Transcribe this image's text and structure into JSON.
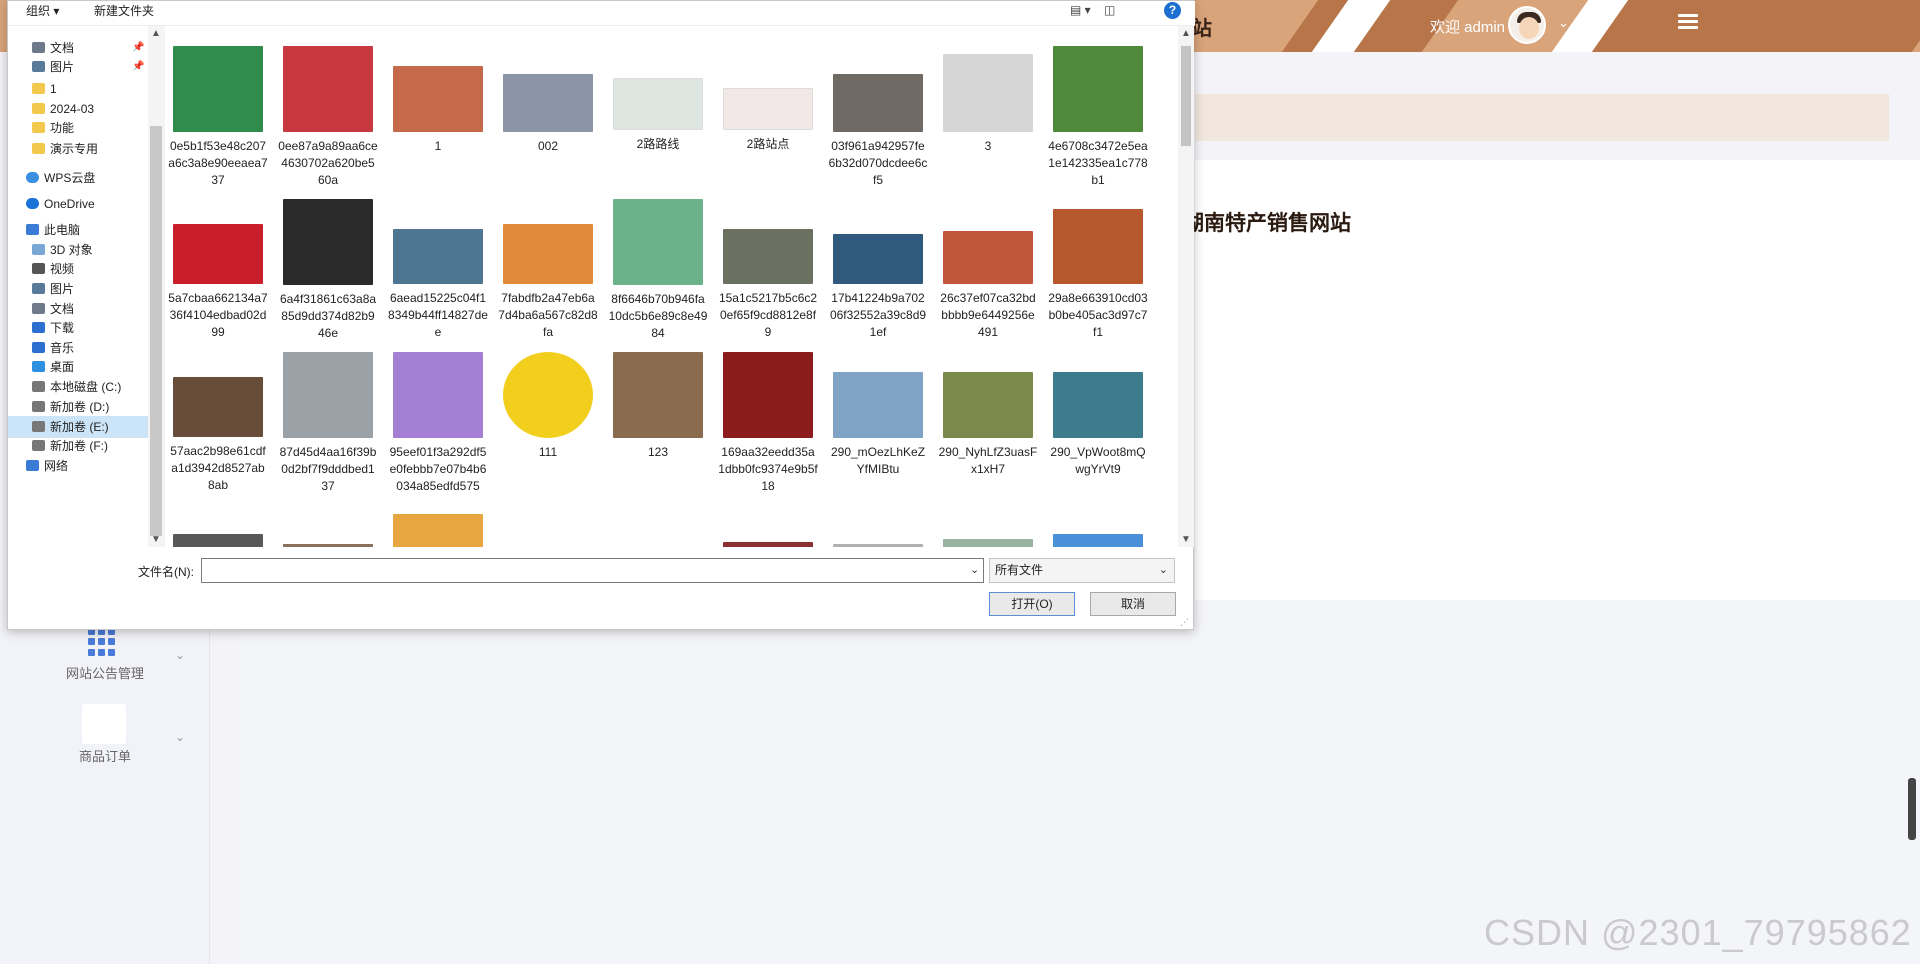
{
  "app": {
    "topbar": {
      "welcome": "欢迎 admin",
      "title_fragment": "站"
    },
    "site_title": "湖南特产销售网站",
    "nav": [
      {
        "label": "网站公告管理",
        "icon": "grid-icon"
      },
      {
        "label": "商品订单",
        "icon": "blank-icon"
      }
    ],
    "watermark": "CSDN @2301_79795862",
    "colors": {
      "topbar": "#d9a47a",
      "banner": "#f1e7dd",
      "accent": "#b8754a"
    }
  },
  "dialog": {
    "toolbar": {
      "organize": "组织 ▾",
      "new_folder": "新建文件夹",
      "help": "?"
    },
    "tree": [
      {
        "label": "文档",
        "icon": "document-icon",
        "pinned": true
      },
      {
        "label": "图片",
        "icon": "picture-icon",
        "pinned": true
      },
      {
        "label": "1",
        "icon": "folder-icon"
      },
      {
        "label": "2024-03",
        "icon": "folder-icon"
      },
      {
        "label": "功能",
        "icon": "folder-icon"
      },
      {
        "label": "演示专用",
        "icon": "folder-icon"
      },
      {
        "label": "WPS云盘",
        "icon": "cloud-icon"
      },
      {
        "label": "OneDrive",
        "icon": "onedrive-icon"
      },
      {
        "label": "此电脑",
        "icon": "computer-icon"
      },
      {
        "label": "3D 对象",
        "icon": "cube-icon"
      },
      {
        "label": "视频",
        "icon": "video-icon"
      },
      {
        "label": "图片",
        "icon": "picture-icon"
      },
      {
        "label": "文档",
        "icon": "document-icon"
      },
      {
        "label": "下载",
        "icon": "download-icon"
      },
      {
        "label": "音乐",
        "icon": "music-icon"
      },
      {
        "label": "桌面",
        "icon": "desktop-icon"
      },
      {
        "label": "本地磁盘 (C:)",
        "icon": "drive-icon"
      },
      {
        "label": "新加卷 (D:)",
        "icon": "drive-icon"
      },
      {
        "label": "新加卷 (E:)",
        "icon": "drive-icon",
        "selected": true
      },
      {
        "label": "新加卷 (F:)",
        "icon": "drive-icon"
      },
      {
        "label": "网络",
        "icon": "network-icon"
      }
    ],
    "files": [
      {
        "name": "0e5b1f53e48c207a6c3a8e90eeaea737",
        "color": "#2f8c4c"
      },
      {
        "name": "0ee87a9a89aa6ce4630702a620be560a",
        "color": "#c6383d"
      },
      {
        "name": "1",
        "color": "#c46a4b"
      },
      {
        "name": "002",
        "color": "#8a96a8"
      },
      {
        "name": "2路路线",
        "color": "#dde6e0"
      },
      {
        "name": "2路站点",
        "color": "#f2e7e7"
      },
      {
        "name": "03f961a942957fe6b32d070dcdee6cf5",
        "color": "#6f6a63"
      },
      {
        "name": "3",
        "color": "#d6d6d6"
      },
      {
        "name": "4e6708c3472e5ea1e142335ea1c778b1",
        "color": "#4f8a3a"
      },
      {
        "name": "5a7cbaa662134a736f4104edbad02d99",
        "color": "#c81f2a"
      },
      {
        "name": "6a4f31861c63a8a85d9dd374d82b946e",
        "color": "#2a2a2a"
      },
      {
        "name": "6aead15225c04f18349b44ff14827dee",
        "color": "#4e7592"
      },
      {
        "name": "7fabdfb2a47eb6a7d4ba6a567c82d8fa",
        "color": "#e28a3b"
      },
      {
        "name": "8f6646b70b946fa10dc5b6e89c8e4984",
        "color": "#6bb28a"
      },
      {
        "name": "15a1c5217b5c6c20ef65f9cd8812e8f9",
        "color": "#6b7160"
      },
      {
        "name": "17b41224b9a70206f32552a39c8d91ef",
        "color": "#2f5a7e"
      },
      {
        "name": "26c37ef07ca32bdbbbb9e6449256e491",
        "color": "#c2563a"
      },
      {
        "name": "29a8e663910cd03b0be405ac3d97c7f1",
        "color": "#b6582c"
      },
      {
        "name": "57aac2b98e61cdfa1d3942d8527ab8ab",
        "color": "#684d3b"
      },
      {
        "name": "87d45d4aa16f39b0d2bf7f9dddbed137",
        "color": "#9aa2a8"
      },
      {
        "name": "95eef01f3a292df5e0febbb7e07b4b6034a85edfd575",
        "color": "#a47fd4"
      },
      {
        "name": "111",
        "color": "#f1cf1c"
      },
      {
        "name": "123",
        "color": "#8a6b4d"
      },
      {
        "name": "169aa32eedd35a1dbb0fc9374e9b5f18",
        "color": "#8c1b1c"
      },
      {
        "name": "290_mOezLhKeZYfMIBtu",
        "color": "#7ea3c4"
      },
      {
        "name": "290_NyhLfZ3uasFx1xH7",
        "color": "#7b8a4a"
      },
      {
        "name": "290_VpWoot8mQwgYrVt9",
        "color": "#3d7c8c"
      },
      {
        "name": "",
        "color": "#585858"
      },
      {
        "name": "",
        "color": "#8a6f5a"
      },
      {
        "name": "",
        "color": "#e8a640"
      },
      {
        "name": "",
        "color": "#ffffff"
      },
      {
        "name": "",
        "color": "#e0e0e0"
      },
      {
        "name": "",
        "color": "#8a3030"
      },
      {
        "name": "",
        "color": "#b0b0b0"
      },
      {
        "name": "",
        "color": "#9ab2a0"
      },
      {
        "name": "",
        "color": "#4a90d8"
      }
    ],
    "filename_label": "文件名(N):",
    "filename_value": "",
    "filetype": "所有文件",
    "open_button": "打开(O)",
    "cancel_button": "取消"
  }
}
